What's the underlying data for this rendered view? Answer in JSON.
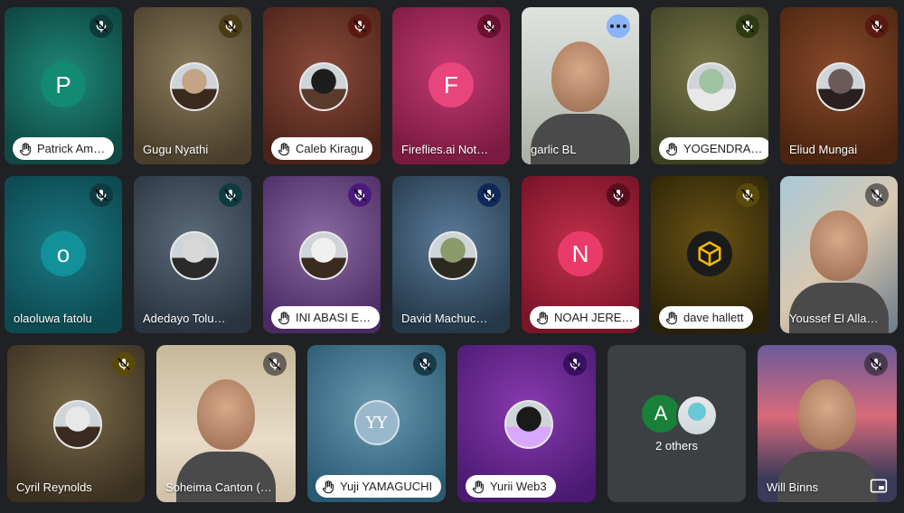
{
  "participants": [
    {
      "name": "Patrick Am…",
      "initial": "P",
      "hand_raised": true,
      "muted": true
    },
    {
      "name": "Gugu Nyathi",
      "hand_raised": false,
      "muted": true
    },
    {
      "name": "Caleb Kiragu",
      "hand_raised": true,
      "muted": true
    },
    {
      "name": "Fireflies.ai Not…",
      "initial": "F",
      "hand_raised": false,
      "muted": true
    },
    {
      "name": "garlic BL",
      "hand_raised": false,
      "muted": false,
      "active_speaker": true
    },
    {
      "name": "YOGENDRA…",
      "hand_raised": true,
      "muted": true
    },
    {
      "name": "Eliud Mungai",
      "hand_raised": false,
      "muted": true
    },
    {
      "name": "olaoluwa fatolu",
      "initial": "o",
      "hand_raised": false,
      "muted": true
    },
    {
      "name": "Adedayo Tolu…",
      "hand_raised": false,
      "muted": true
    },
    {
      "name": "INI ABASI E…",
      "hand_raised": true,
      "muted": true
    },
    {
      "name": "David Machuc…",
      "hand_raised": false,
      "muted": true
    },
    {
      "name": "NOAH JERE…",
      "initial": "N",
      "hand_raised": true,
      "muted": true
    },
    {
      "name": "dave hallett",
      "hand_raised": true,
      "muted": true
    },
    {
      "name": "Youssef El Alla…",
      "hand_raised": false,
      "muted": true
    },
    {
      "name": "Cyril Reynolds",
      "hand_raised": false,
      "muted": true
    },
    {
      "name": "Soheima Canton (…",
      "hand_raised": false,
      "muted": true
    },
    {
      "name": "Yuji YAMAGUCHI",
      "initial": "YY",
      "hand_raised": true,
      "muted": true
    },
    {
      "name": "Yurii Web3",
      "hand_raised": true,
      "muted": true
    },
    {
      "name": "Will Binns",
      "hand_raised": false,
      "muted": true
    }
  ],
  "others_tile": {
    "label": "2 others",
    "initial": "A"
  },
  "colors": {
    "page_bg": "#202124",
    "active_border": "#a8c7fa",
    "chip_bg": "#ffffff"
  },
  "icons": {
    "mic_off": "mic-off-icon",
    "hand": "raised-hand-icon",
    "more": "more-options-icon",
    "pip": "picture-in-picture-icon"
  }
}
